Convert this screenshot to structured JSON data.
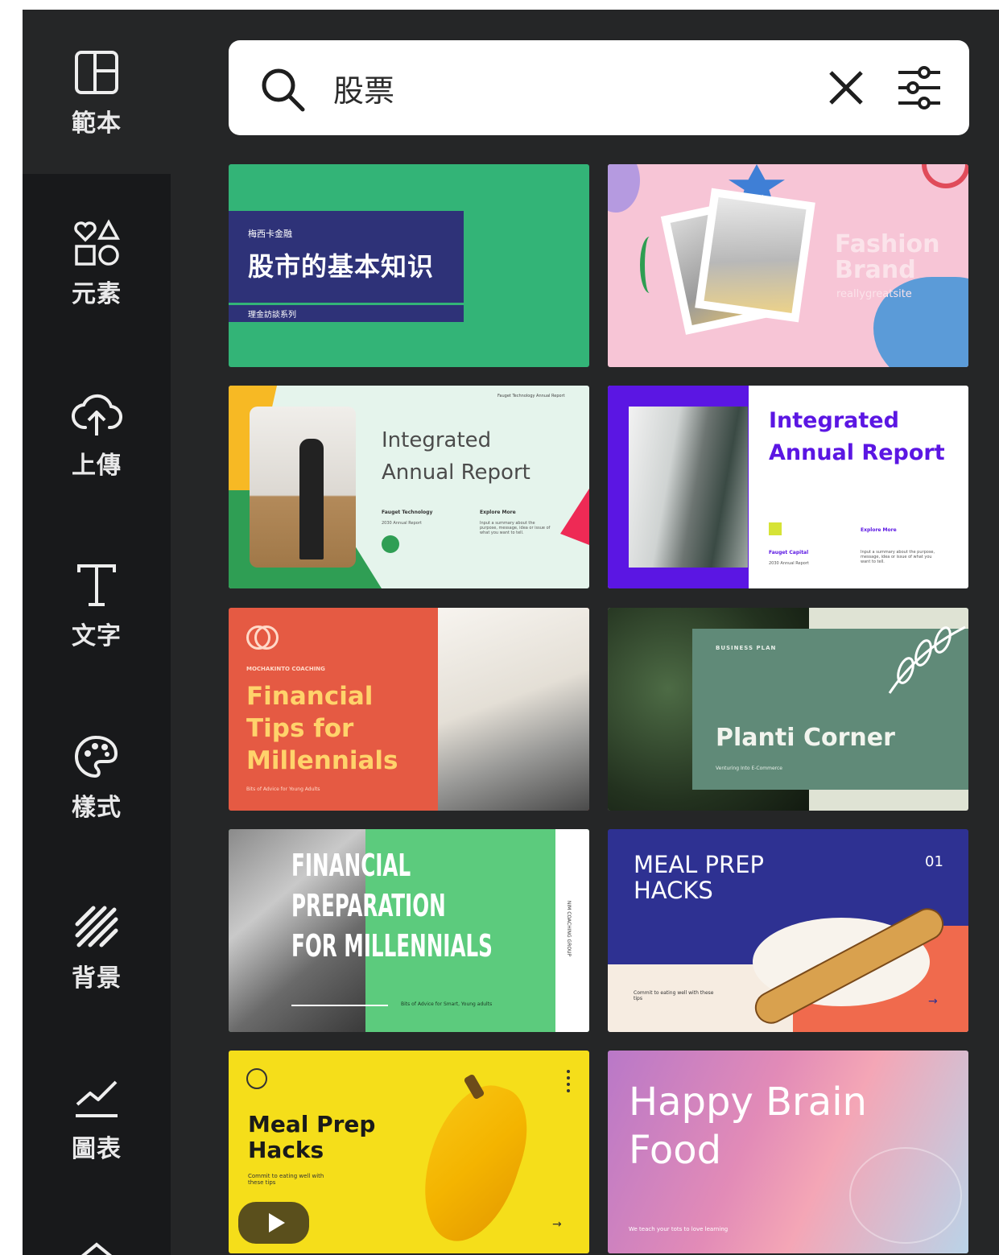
{
  "sidebar": {
    "items": [
      {
        "label": "範本",
        "icon": "template-icon"
      },
      {
        "label": "元素",
        "icon": "elements-icon"
      },
      {
        "label": "上傳",
        "icon": "upload-cloud-icon"
      },
      {
        "label": "文字",
        "icon": "text-icon"
      },
      {
        "label": "樣式",
        "icon": "palette-icon"
      },
      {
        "label": "背景",
        "icon": "background-stripes-icon"
      },
      {
        "label": "圖表",
        "icon": "chart-icon"
      }
    ]
  },
  "search": {
    "value": "股票",
    "icons": [
      "search-icon",
      "clear-icon",
      "filter-icon"
    ]
  },
  "templates": [
    {
      "sub": "梅西卡金融",
      "title": "股市的基本知识",
      "footer": "理金訪談系列",
      "bg": "#33b477",
      "band": "#2e3278"
    },
    {
      "title1": "Fashion",
      "title2": "Brand",
      "site": "reallygreatsite",
      "bg": "#f7c5d6"
    },
    {
      "title1": "Integrated",
      "title2": "Annual Report",
      "header": "Fauget Technology Annual Report",
      "company": "Fauget Technology",
      "year": "2030 Annual Report",
      "explore": "Explore More",
      "desc": "Input a summary about the purpose, message, idea or issue of what you want to tell.",
      "bg": "#e5f4ec"
    },
    {
      "title1": "Integrated",
      "title2": "Annual Report",
      "company": "Fauget Capital",
      "year": "2030 Annual Report",
      "explore": "Explore More",
      "desc": "Input a summary about the purpose, message, idea or issue of what you want to tell.",
      "accent": "#5b16e3"
    },
    {
      "brand": "MOCHAKINTO COACHING",
      "title": [
        "Financial",
        "Tips for",
        "Millennials"
      ],
      "sub": "Bits of Advice for Young Adults",
      "bg": "#e55a43",
      "text_color": "#ffd36b"
    },
    {
      "kicker": "BUSINESS PLAN",
      "title": "Planti Corner",
      "sub": "Venturing Into E-Commerce",
      "panel": "#608a78"
    },
    {
      "title": [
        "FINANCIAL",
        "PREPARATION",
        "FOR MILLENNIALS"
      ],
      "sub": "Bits of Advice for Smart, Young adults",
      "side": "NIM COACHING GROUP",
      "green": "#5ccb7d"
    },
    {
      "title": [
        "MEAL PREP",
        "HACKS"
      ],
      "num": "01",
      "sub": "Commit to eating well with these tips",
      "bg": "#2e3192"
    },
    {
      "title": [
        "Meal Prep",
        "Hacks"
      ],
      "sub": "Commit to eating well with these tips",
      "bg": "#f5de1a"
    },
    {
      "title": [
        "Happy Brain",
        "Food"
      ],
      "sub": "We teach your tots to love learning"
    }
  ]
}
